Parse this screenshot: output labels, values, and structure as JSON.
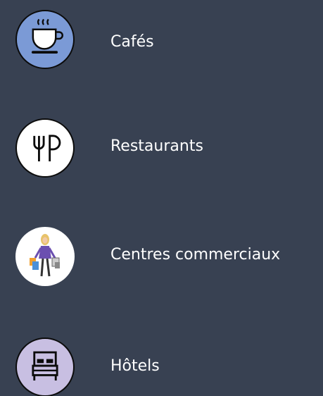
{
  "categories": [
    {
      "label": "Cafés",
      "icon": "coffee-cup-icon",
      "icon_bg": "#7b9ad6"
    },
    {
      "label": "Restaurants",
      "icon": "fork-knife-icon",
      "icon_bg": "#ffffff"
    },
    {
      "label": "Centres commerciaux",
      "icon": "shopping-woman-icon",
      "icon_bg": "#ffffff"
    },
    {
      "label": "Hôtels",
      "icon": "bed-icon",
      "icon_bg": "#c8bfe2"
    }
  ],
  "colors": {
    "background": "#384152",
    "text": "#ffffff",
    "icon_outline": "#0c0c0c"
  }
}
